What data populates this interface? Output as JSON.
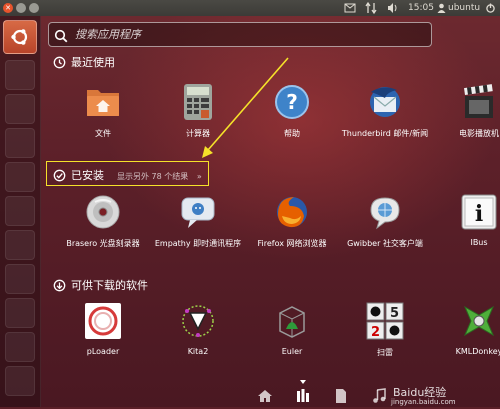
{
  "top_panel": {
    "time": "15:05",
    "user": "ubuntu"
  },
  "search": {
    "placeholder": "搜索应用程序"
  },
  "sections": {
    "recent": {
      "title": "最近使用",
      "apps": [
        {
          "label": "文件",
          "icon": "folder-icon"
        },
        {
          "label": "计算器",
          "icon": "calculator-icon"
        },
        {
          "label": "帮助",
          "icon": "help-icon"
        },
        {
          "label": "Thunderbird 邮件/新闻",
          "icon": "thunderbird-icon"
        },
        {
          "label": "电影播放机",
          "icon": "movie-player-icon"
        }
      ]
    },
    "installed": {
      "title": "已安装",
      "more": "显示另外 78 个结果",
      "more_arrow": "»",
      "apps": [
        {
          "label": "Brasero 光盘刻录器",
          "icon": "brasero-icon"
        },
        {
          "label": "Empathy 即时通讯程序",
          "icon": "empathy-icon"
        },
        {
          "label": "Firefox 网络浏览器",
          "icon": "firefox-icon"
        },
        {
          "label": "Gwibber 社交客户端",
          "icon": "gwibber-icon"
        },
        {
          "label": "IBus",
          "icon": "ibus-icon"
        }
      ]
    },
    "download": {
      "title": "可供下载的软件",
      "apps": [
        {
          "label": "pLoader",
          "icon": "ploader-icon"
        },
        {
          "label": "Kita2",
          "icon": "kita2-icon"
        },
        {
          "label": "Euler",
          "icon": "euler-icon"
        },
        {
          "label": "扫雷",
          "icon": "minesweeper-icon"
        },
        {
          "label": "KMLDonkey",
          "icon": "kmldonkey-icon"
        }
      ]
    }
  },
  "watermark": {
    "text": "Baidu经验",
    "sub": "jingyan.baidu.com"
  },
  "colors": {
    "highlight": "#f5e22a",
    "accent": "#dd4814"
  }
}
